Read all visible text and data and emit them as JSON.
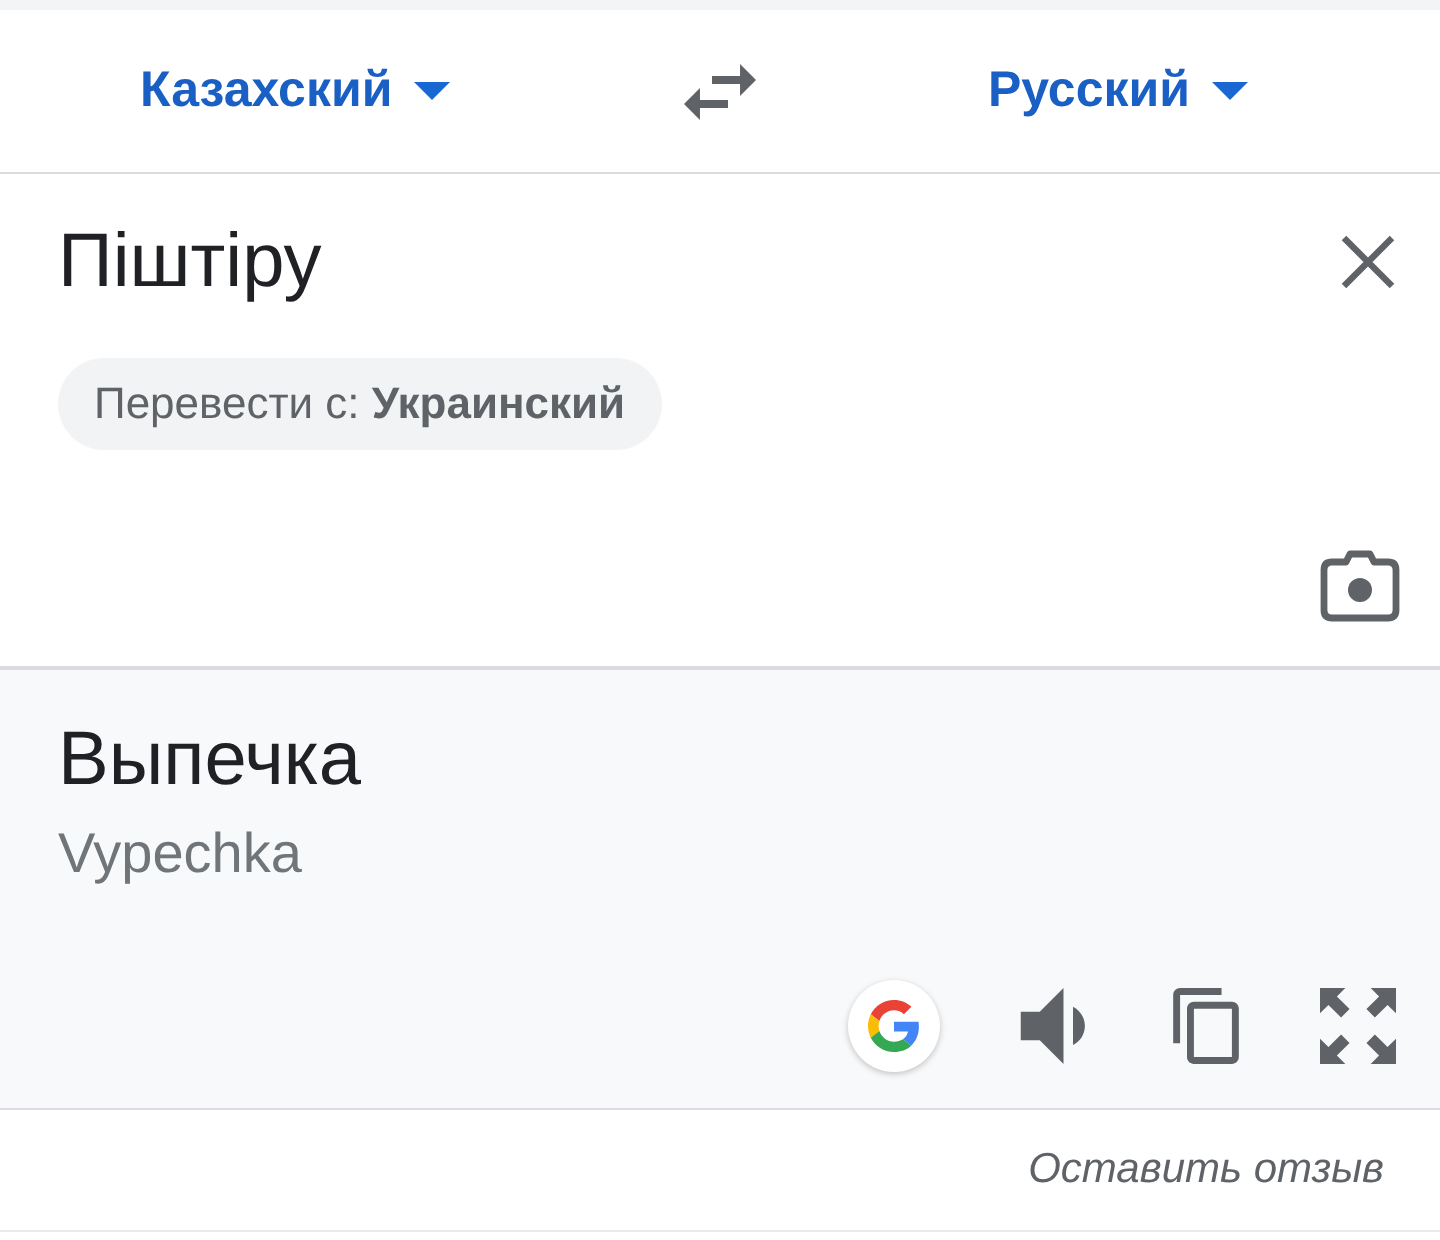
{
  "language_bar": {
    "source_language": "Казахский",
    "target_language": "Русский"
  },
  "input": {
    "text": "Піштіру",
    "detected_chip": "Перевести с: **Украинский**"
  },
  "output": {
    "translation": "Выпечка",
    "transliteration": "Vypechka"
  },
  "feedback_link": "Оставить отзыв"
}
